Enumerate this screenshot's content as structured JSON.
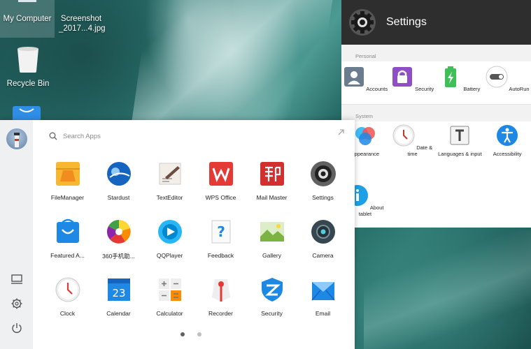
{
  "desktop": {
    "icons": [
      {
        "label": "My Computer"
      },
      {
        "label": "Screenshot _2017...4.jpg"
      },
      {
        "label": "Recycle Bin"
      }
    ]
  },
  "settings": {
    "title": "Settings",
    "sections": [
      {
        "label": "Personal",
        "items": [
          {
            "label": "Accounts",
            "icon": "accounts-icon",
            "color": "#6b7c8e"
          },
          {
            "label": "Security",
            "icon": "lock-icon",
            "color": "#8e4fc4"
          },
          {
            "label": "Battery",
            "icon": "battery-icon",
            "color": "#3fbf58"
          },
          {
            "label": "AutoRun",
            "icon": "toggle-icon",
            "color": "#555555"
          }
        ]
      },
      {
        "label": "System",
        "items": [
          {
            "label": "Appearance",
            "icon": "appearance-icon",
            "color": "#2b8fe0"
          },
          {
            "label": "Date & time",
            "icon": "clock-icon",
            "color": "#c0392b"
          },
          {
            "label": "Languages & input",
            "icon": "keyboard-icon",
            "color": "#444444"
          },
          {
            "label": "Accessibility",
            "icon": "accessibility-icon",
            "color": "#1e88e5"
          },
          {
            "label": "About tablet",
            "icon": "info-icon",
            "color": "#1ea0e6"
          }
        ]
      }
    ]
  },
  "drawer": {
    "search_placeholder": "Search Apps",
    "apps": [
      {
        "label": "FileManager",
        "icon": "file-manager-icon",
        "color": "#f5a623"
      },
      {
        "label": "Stardust",
        "icon": "stardust-icon",
        "color": "#1565c0"
      },
      {
        "label": "TextEditor",
        "icon": "text-editor-icon",
        "color": "#8d6e63"
      },
      {
        "label": "WPS Office",
        "icon": "wps-office-icon",
        "color": "#e53935"
      },
      {
        "label": "Mail Master",
        "icon": "mail-master-icon",
        "color": "#d32f2f"
      },
      {
        "label": "Settings",
        "icon": "settings-gear-icon",
        "color": "#424242"
      },
      {
        "label": "Featured A...",
        "icon": "store-bag-icon",
        "color": "#1e88e5"
      },
      {
        "label": "360手机助...",
        "icon": "360-assistant-icon",
        "color": "#43a047"
      },
      {
        "label": "QQPlayer",
        "icon": "qqplayer-icon",
        "color": "#29b6f6"
      },
      {
        "label": "Feedback",
        "icon": "feedback-icon",
        "color": "#1e88e5"
      },
      {
        "label": "Gallery",
        "icon": "gallery-icon",
        "color": "#7cb342"
      },
      {
        "label": "Camera",
        "icon": "camera-icon",
        "color": "#37474f"
      },
      {
        "label": "Clock",
        "icon": "clock-app-icon",
        "color": "#e53935"
      },
      {
        "label": "Calendar",
        "icon": "calendar-icon",
        "color": "#1e88e5"
      },
      {
        "label": "Calculator",
        "icon": "calculator-icon",
        "color": "#fb8c00"
      },
      {
        "label": "Recorder",
        "icon": "recorder-icon",
        "color": "#e53935"
      },
      {
        "label": "Security",
        "icon": "shield-icon",
        "color": "#1e88e5"
      },
      {
        "label": "Email",
        "icon": "email-icon",
        "color": "#1e88e5"
      }
    ],
    "calendar_day": "23",
    "page_count": 2,
    "current_page": 1
  }
}
